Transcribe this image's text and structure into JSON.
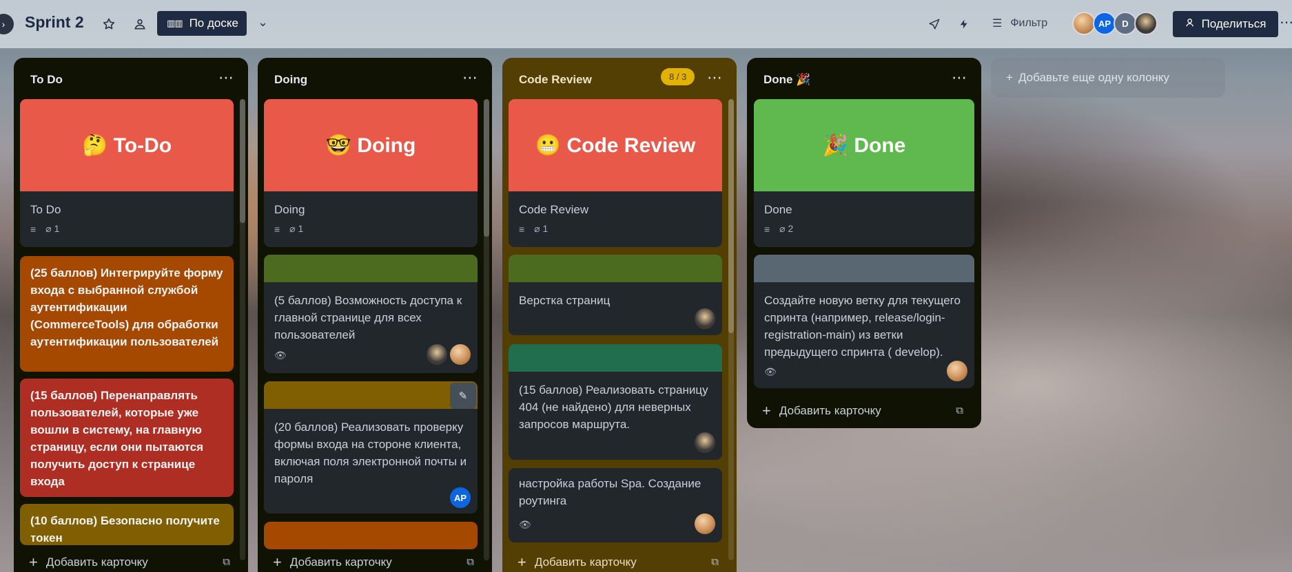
{
  "header": {
    "board_title": "Sprint 2",
    "view_label": "По доске",
    "filter_label": "Фильтр",
    "share_label": "Поделиться",
    "avatars": [
      {
        "initials": "",
        "color": "#c9905a"
      },
      {
        "initials": "AP",
        "color": "#0c66e4"
      },
      {
        "initials": "D",
        "color": "#5e6c84"
      },
      {
        "initials": "",
        "color": "#3b3a38"
      }
    ]
  },
  "lists": [
    {
      "title": "To Do",
      "cards": [
        {
          "cover_text": "🤔 To-Do",
          "cover_color": "#e9594a",
          "title": "To Do",
          "attachments": "1"
        },
        {
          "title": "(25 баллов) Интегрируйте форму входа с выбранной службой аутентификации (CommerceTools) для обработки аутентификации пользователей",
          "color": "#a54800"
        },
        {
          "title": "(15 баллов) Перенаправлять пользователей, которые уже вошли в систему, на главную страницу, если они пытаются получить доступ к странице входа",
          "color": "#ae2e24"
        },
        {
          "title": "(10 баллов) Безопасно получите токен",
          "color": "#7f5f01"
        }
      ],
      "add_card": "Добавить карточку"
    },
    {
      "title": "Doing",
      "cards": [
        {
          "cover_text": "🤓 Doing",
          "cover_color": "#e9594a",
          "title": "Doing",
          "attachments": "1"
        },
        {
          "title": "(5 баллов) Возможность доступа к главной странице для всех пользователей",
          "cover_color": "#4c6b1f"
        },
        {
          "title": "(20 баллов) Реализовать проверку формы входа на стороне клиента, включая поля электронной почты и пароля",
          "cover_color": "#7f5f01",
          "member": "AP"
        },
        {
          "title": "",
          "cover_color": "#a54800"
        }
      ],
      "add_card": "Добавить карточку"
    },
    {
      "title": "Code Review",
      "wip": "8 / 3",
      "cards": [
        {
          "cover_text": "😬 Code Review",
          "cover_color": "#e9594a",
          "title": "Code Review",
          "attachments": "1"
        },
        {
          "title": "Верстка страниц",
          "cover_color": "#4c6b1f"
        },
        {
          "title": "(15 баллов) Реализовать страницу 404 (не найдено) для неверных запросов маршрута.",
          "cover_color": "#216e4e"
        },
        {
          "title": "настройка работы Spa. Создание роутинга"
        }
      ],
      "add_card": "Добавить карточку"
    },
    {
      "title": "Done 🎉",
      "cards": [
        {
          "cover_text": "🎉 Done",
          "cover_color": "#5fb94f",
          "title": "Done",
          "attachments": "2"
        },
        {
          "title": "Создайте новую ветку для текущего спринта (например, release/login-registration-main) из ветки предыдущего спринта ( develop).",
          "cover_color": "#596773"
        }
      ],
      "add_card": "Добавить карточку"
    }
  ],
  "add_list_label": "Добавьте еще одну колонку"
}
